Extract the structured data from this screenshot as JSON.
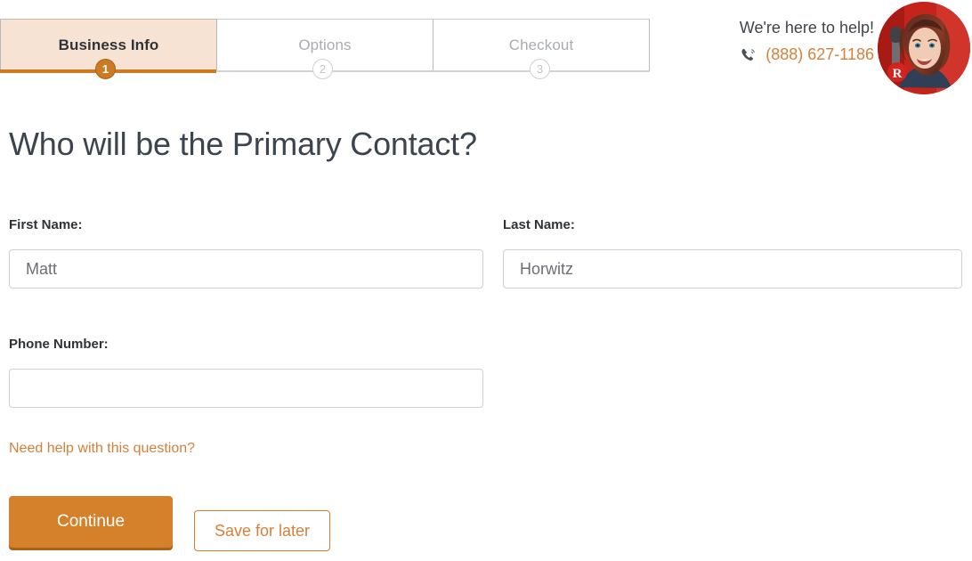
{
  "steps": [
    {
      "label": "Business Info",
      "number": "1",
      "state": "active"
    },
    {
      "label": "Options",
      "number": "2",
      "state": "todo"
    },
    {
      "label": "Checkout",
      "number": "3",
      "state": "todo"
    }
  ],
  "help": {
    "title": "We're here to help!",
    "phone": "(888) 627-1186",
    "phone_icon": "phone-ringing-icon",
    "avatar_icon": "support-agent-avatar",
    "avatar_badge_letter": "R"
  },
  "main": {
    "page_title": "Who will be the Primary Contact?",
    "fields": [
      {
        "label": "First Name:",
        "value": "Matt",
        "placeholder": ""
      },
      {
        "label": "Last Name:",
        "value": "Horwitz",
        "placeholder": ""
      },
      {
        "label": "Phone Number:",
        "value": "",
        "placeholder": ""
      }
    ],
    "help_link": "Need help with this question?"
  },
  "actions": {
    "continue_label": "Continue",
    "save_label": "Save for later"
  },
  "colors": {
    "accent_orange": "#d5802b",
    "accent_orange_dark": "#a96216",
    "accent_orange_text": "#d5803a",
    "active_tab_bg": "#f7e3d4",
    "muted_text": "#a9adb3",
    "heading_text": "#3c4450",
    "rail_gray": "#d3d3d3"
  }
}
